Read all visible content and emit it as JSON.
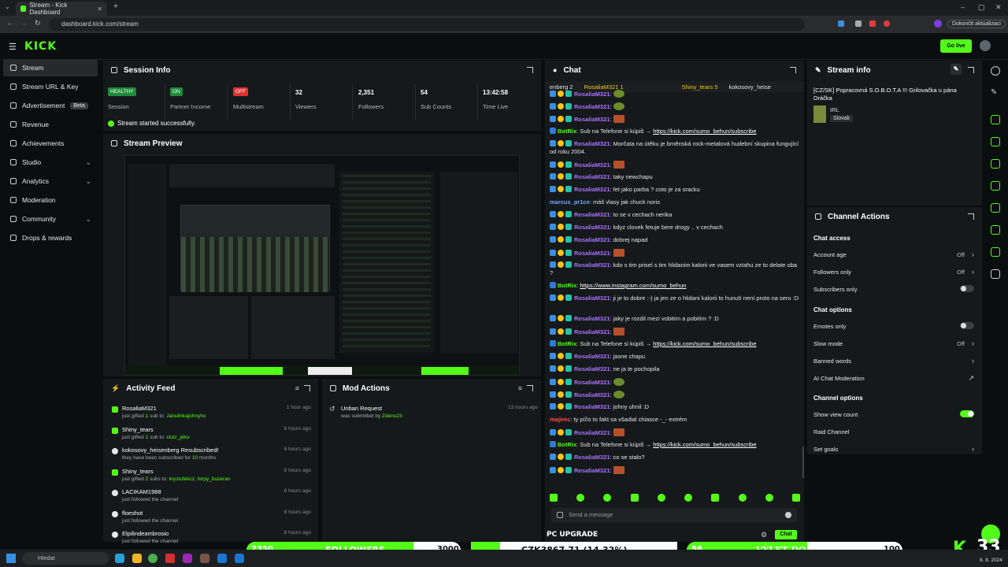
{
  "browser": {
    "tab_title": "Stream - Kick Dashboard",
    "url": "dashboard.kick.com/stream",
    "update_label": "Dokončit aktualizaci"
  },
  "topbar": {
    "logo": "KICK",
    "golive_label": "Go live"
  },
  "sidebar": {
    "items": [
      {
        "label": "Stream",
        "active": true
      },
      {
        "label": "Stream URL & Key"
      },
      {
        "label": "Advertisement",
        "badge": "Beta"
      },
      {
        "label": "Revenue"
      },
      {
        "label": "Achievements"
      },
      {
        "label": "Studio",
        "chevron": "⌄"
      },
      {
        "label": "Analytics",
        "chevron": "⌄"
      },
      {
        "label": "Moderation"
      },
      {
        "label": "Community",
        "chevron": "⌄"
      },
      {
        "label": "Drops & rewards"
      }
    ]
  },
  "session": {
    "title": "Session Info",
    "stats": [
      {
        "tag": "HEALTHY",
        "label": "Session"
      },
      {
        "tag": "ON",
        "label": "Partner Income"
      },
      {
        "tag": "OFF",
        "label": "Multistream"
      },
      {
        "value": "32",
        "label": "Viewers"
      },
      {
        "value": "2,351",
        "label": "Followers"
      },
      {
        "value": "54",
        "label": "Sub Counts"
      },
      {
        "value": "13:42:58",
        "label": "Time Live"
      }
    ],
    "status_message": "Stream started successfully."
  },
  "preview": {
    "title": "Stream Preview"
  },
  "activity": {
    "title": "Activity Feed",
    "items": [
      {
        "name": "RosaliaM321",
        "desc_prefix": "just gifted ",
        "desc_num": "1",
        "desc_mid": " sub to: ",
        "desc_target": "Janulinkajohnyho",
        "time": "1 hour ago",
        "icon": "gift-icon"
      },
      {
        "name": "Shiny_tears",
        "desc_prefix": "just gifted ",
        "desc_num": "1",
        "desc_mid": " sub to: ",
        "desc_target": "clutz_piko",
        "time": "6 hours ago",
        "icon": "gift-icon"
      },
      {
        "name": "kokosovy_heisenberg Resubscribed!",
        "desc_prefix": "they have been subscribed for ",
        "desc_num": "10",
        "desc_mid": " months",
        "desc_target": "",
        "time": "8 hours ago",
        "icon": "star-icon"
      },
      {
        "name": "Shiny_tears",
        "desc_prefix": "just gifted ",
        "desc_num": "2",
        "desc_mid": " subs to: ",
        "desc_target": "krystufekcz, forpy_buzeran",
        "time": "8 hours ago",
        "icon": "gift-icon"
      },
      {
        "name": "LACIKAM1988",
        "desc_prefix": "just followed the channel",
        "desc_num": "",
        "desc_mid": "",
        "desc_target": "",
        "time": "8 hours ago",
        "icon": "heart-icon"
      },
      {
        "name": "floeshot",
        "desc_prefix": "just followed the channel",
        "desc_num": "",
        "desc_mid": "",
        "desc_target": "",
        "time": "8 hours ago",
        "icon": "heart-icon"
      },
      {
        "name": "Elpilindeambrosio",
        "desc_prefix": "just followed the channel",
        "desc_num": "",
        "desc_mid": "",
        "desc_target": "",
        "time": "8 hours ago",
        "icon": "heart-icon"
      }
    ]
  },
  "mod_actions": {
    "title": "Mod Actions",
    "items": [
      {
        "action": "Unban Request",
        "desc": "was submitted by ",
        "user": "Zdeno23",
        "time": "13 hours ago"
      }
    ]
  },
  "chat": {
    "title": "Chat",
    "pinned": [
      "enberg 2",
      "RosaliaM321 1",
      "Shiny_tears 5",
      "kokosovy_heise"
    ],
    "messages": [
      {
        "user": "RosaliaM321",
        "color": "#a970ff",
        "text": "",
        "emote": "g",
        "badges": 3
      },
      {
        "user": "RosaliaM321",
        "color": "#a970ff",
        "text": "",
        "emote": "g",
        "badges": 3
      },
      {
        "user": "RosaliaM321",
        "color": "#a970ff",
        "text": "",
        "emote": "r",
        "badges": 3
      },
      {
        "user": "BotRix",
        "color": "#53fc18",
        "text": "Sub na Telefone si kúpiš → ",
        "link": "https://kick.com/sumo_behun/subscribe",
        "badges": 1
      },
      {
        "user": "RosaliaM321",
        "color": "#a970ff",
        "text": "Morčata na útěku je brněnská rock-metalová hudební skupina fungující od roku 2004.",
        "badges": 3,
        "lines": 2
      },
      {
        "user": "RosaliaM321",
        "color": "#a970ff",
        "text": "",
        "emote": "r",
        "badges": 3
      },
      {
        "user": "RosaliaM321",
        "color": "#a970ff",
        "text": "taky newchapu",
        "badges": 3
      },
      {
        "user": "RosaliaM321",
        "color": "#a970ff",
        "text": "fet jako parba ? coto je za sracku",
        "badges": 3
      },
      {
        "user": "marcus_pr1ce",
        "color": "#6fa8ff",
        "text": "máš vlasy jak chuck noris",
        "badges": 0
      },
      {
        "user": "RosaliaM321",
        "color": "#a970ff",
        "text": "to se v cechach nerika",
        "badges": 3
      },
      {
        "user": "RosaliaM321",
        "color": "#a970ff",
        "text": "kdyz clovek fetuje bere drogy .. v cechach",
        "badges": 3
      },
      {
        "user": "RosaliaM321",
        "color": "#a970ff",
        "text": "dobrej napad",
        "badges": 3
      },
      {
        "user": "RosaliaM321",
        "color": "#a970ff",
        "text": "",
        "emote": "r",
        "badges": 3
      },
      {
        "user": "RosaliaM321",
        "color": "#a970ff",
        "text": "kdo s tim prisel s tim hlidanim kalorii ve vasem vztahu ze to delate oba ?",
        "badges": 3,
        "lines": 2
      },
      {
        "user": "BotRix",
        "color": "#53fc18",
        "text": "",
        "link": "https://www.instagram.com/sumo_behun",
        "badges": 1
      },
      {
        "user": "RosaliaM321",
        "color": "#a970ff",
        "text": "ji je to dobre :-) ja jen ze o hlidani kalorii to hunutí není proto na seru :D",
        "badges": 3,
        "lines": 2
      },
      {
        "user": "RosaliaM321",
        "color": "#a970ff",
        "text": "jaky je rozdil mezi vobitím a pobitím ? :D",
        "badges": 3
      },
      {
        "user": "RosaliaM321",
        "color": "#a970ff",
        "text": "",
        "emote": "r",
        "badges": 3
      },
      {
        "user": "BotRix",
        "color": "#53fc18",
        "text": "Sub na Telefone si kúpiš → ",
        "link": "https://kick.com/sumo_behun/subscribe",
        "badges": 1
      },
      {
        "user": "RosaliaM321",
        "color": "#a970ff",
        "text": "jasne chapu",
        "badges": 3
      },
      {
        "user": "RosaliaM321",
        "color": "#a970ff",
        "text": "ne ja te pochopila",
        "badges": 3
      },
      {
        "user": "RosaliaM321",
        "color": "#a970ff",
        "text": "",
        "emote": "g",
        "badges": 3
      },
      {
        "user": "RosaliaM321",
        "color": "#a970ff",
        "text": "",
        "emote": "g",
        "badges": 3
      },
      {
        "user": "RosaliaM321",
        "color": "#a970ff",
        "text": "johny uhnil :D",
        "badges": 3
      },
      {
        "user": "majirec",
        "color": "#ff4d4d",
        "text": "ty píčo to fakt sa všadial chiasce -_- extrém",
        "badges": 0
      },
      {
        "user": "RosaliaM321",
        "color": "#a970ff",
        "text": "",
        "emote": "r",
        "badges": 3
      },
      {
        "user": "BotRix",
        "color": "#53fc18",
        "text": "Sub na Telefone si kúpiš → ",
        "link": "https://kick.com/sumo_behun/subscribe",
        "badges": 1
      },
      {
        "user": "RosaliaM321",
        "color": "#a970ff",
        "text": "co se stalo?",
        "badges": 3
      },
      {
        "user": "RosaliaM321",
        "color": "#a970ff",
        "text": "",
        "emote": "r",
        "badges": 3
      }
    ],
    "input_placeholder": "Send a message",
    "send_label": "Chat"
  },
  "stream_info": {
    "title": "Stream info",
    "stream_title": "[CZ/SK] Popracovná S.O.B.O.T.A !!! Grilovačka u pána Dráčka",
    "category": "IRL",
    "language": "Slovak"
  },
  "channel_actions": {
    "title": "Channel Actions",
    "chat_access_title": "Chat access",
    "account_age": {
      "label": "Account age",
      "value": "Off"
    },
    "followers_only": {
      "label": "Followers only",
      "value": "Off"
    },
    "subscribers_only": {
      "label": "Subscribers only"
    },
    "chat_options_title": "Chat options",
    "emotes_only": {
      "label": "Emotes only"
    },
    "slow_mode": {
      "label": "Slow mode",
      "value": "Off"
    },
    "banned_words": {
      "label": "Banned words"
    },
    "ai_moderation": {
      "label": "AI Chat Moderation"
    },
    "channel_options_title": "Channel options",
    "show_view_count": {
      "label": "Show view count"
    },
    "raid_channel": {
      "label": "Raid Channel"
    },
    "set_goals": {
      "label": "Set goals"
    }
  },
  "overlays": {
    "followers_goal": {
      "current": "2350",
      "label": "FOLLOWERS",
      "target": "3000",
      "progress": 0.78
    },
    "donation": {
      "text": "CZK3867.71 (14.32%)",
      "progress": 0.14
    },
    "trip_goal": {
      "current": "56",
      "label": "VÝLET DO PŘÍRODY",
      "target": "100",
      "progress": 0.56
    },
    "brand": "PC UPGRADE",
    "viewer_badge": "33",
    "date": "8. 8. 2024"
  },
  "taskbar": {
    "search_placeholder": "Hledat"
  },
  "colors": {
    "accent": "#53fc18",
    "background": "#0b0e0f",
    "panel": "#16191b"
  }
}
